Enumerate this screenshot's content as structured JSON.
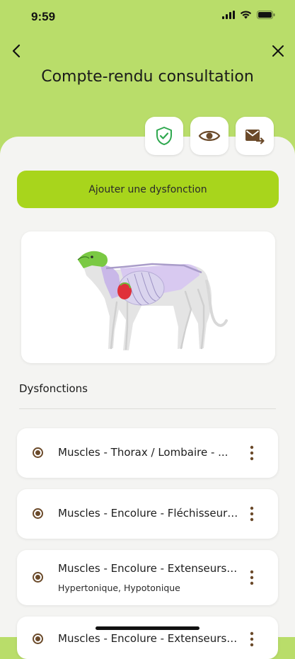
{
  "status_bar": {
    "time": "9:59"
  },
  "header": {
    "title": "Compte-rendu consultation"
  },
  "actions": {
    "validate_icon": "shield-check-icon",
    "preview_icon": "eye-icon",
    "send_icon": "mail-forward-icon"
  },
  "add_button_label": "Ajouter une dysfonction",
  "section_title": "Dysfonctions",
  "items": [
    {
      "label": "Muscles - Thorax / Lombaire - ...",
      "sub": ""
    },
    {
      "label": "Muscles - Encolure - Fléchisseurs...",
      "sub": ""
    },
    {
      "label": "Muscles - Encolure - Extenseurs ...",
      "sub": "Hypertonique, Hypotonique"
    },
    {
      "label": "Muscles - Encolure - Extenseurs ...",
      "sub": ""
    }
  ],
  "colors": {
    "accent_green": "#a8d51c",
    "header_green": "#b9dd6a",
    "brown": "#6b4a2a"
  }
}
